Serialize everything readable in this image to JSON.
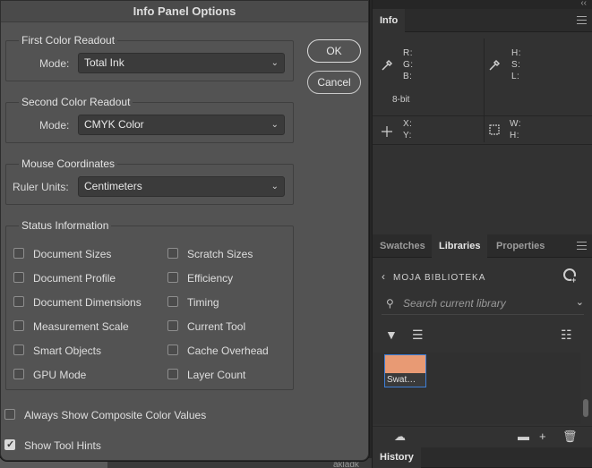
{
  "dialog": {
    "title": "Info Panel Options",
    "first_readout": {
      "title": "First Color Readout",
      "mode_label": "Mode:",
      "mode_value": "Total Ink"
    },
    "second_readout": {
      "title": "Second Color Readout",
      "mode_label": "Mode:",
      "mode_value": "CMYK Color"
    },
    "mouse_coordinates": {
      "title": "Mouse Coordinates",
      "units_label": "Ruler Units:",
      "units_value": "Centimeters"
    },
    "status": {
      "title": "Status Information",
      "items": [
        {
          "label": "Document Sizes",
          "checked": false
        },
        {
          "label": "Scratch Sizes",
          "checked": false
        },
        {
          "label": "Document Profile",
          "checked": false
        },
        {
          "label": "Efficiency",
          "checked": false
        },
        {
          "label": "Document Dimensions",
          "checked": false
        },
        {
          "label": "Timing",
          "checked": false
        },
        {
          "label": "Measurement Scale",
          "checked": false
        },
        {
          "label": "Current Tool",
          "checked": false
        },
        {
          "label": "Smart Objects",
          "checked": false
        },
        {
          "label": "Cache Overhead",
          "checked": false
        },
        {
          "label": "GPU Mode",
          "checked": false
        },
        {
          "label": "Layer Count",
          "checked": false
        }
      ]
    },
    "always_show_composite": {
      "label": "Always Show Composite Color Values",
      "checked": false
    },
    "show_tool_hints": {
      "label": "Show Tool Hints",
      "checked": true
    },
    "ok_label": "OK",
    "cancel_label": "Cancel"
  },
  "info_panel": {
    "tab": "Info",
    "rgb_labels": [
      "R:",
      "G:",
      "B:"
    ],
    "hsl_labels": [
      "H:",
      "S:",
      "L:"
    ],
    "bit_depth": "8-bit",
    "xy_labels": [
      "X:",
      "Y:"
    ],
    "wh_labels": [
      "W:",
      "H:"
    ]
  },
  "libraries_panel": {
    "tabs": [
      "Swatches",
      "Libraries",
      "Properties"
    ],
    "active_tab": "Libraries",
    "library_name": "MOJA BIBLIOTEKA",
    "search_placeholder": "Search current library",
    "swatch": {
      "name": "Swat…",
      "color": "#e89a74"
    }
  },
  "history_panel": {
    "tab": "History"
  },
  "background": {
    "fragment": "akladk"
  }
}
